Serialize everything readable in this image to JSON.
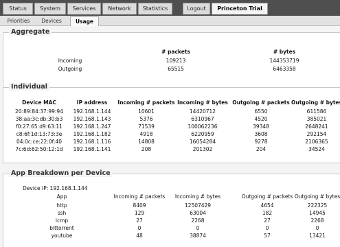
{
  "nav": {
    "tabs": [
      "Status",
      "System",
      "Services",
      "Network",
      "Statistics",
      "Logout",
      "Princeton Trial"
    ]
  },
  "subnav": {
    "tabs": [
      "Priorities",
      "Devices",
      "Usage"
    ]
  },
  "aggregate": {
    "title": "Aggregate",
    "headers": [
      "# packets",
      "# bytes"
    ],
    "rows": [
      {
        "label": "Incoming",
        "packets": "109213",
        "bytes": "144353719"
      },
      {
        "label": "Outgoing",
        "packets": "65515",
        "bytes": "6463358"
      }
    ]
  },
  "individual": {
    "title": "Individual",
    "headers": [
      "Device MAC",
      "IP address",
      "Incoming # packets",
      "Incoming # bytes",
      "Outgoing # packets",
      "Outgoing # bytes"
    ],
    "rows": [
      [
        "20:89:84:37:99:94",
        "192.168.1.144",
        "10601",
        "14420712",
        "6550",
        "611586"
      ],
      [
        "38:aa:3c:db:30:b3",
        "192.168.1.143",
        "5376",
        "6310967",
        "4520",
        "385021"
      ],
      [
        "f0:27:65:d9:63:11",
        "192.168.1.247",
        "71539",
        "100062236",
        "39348",
        "2648241"
      ],
      [
        "c8:6f:1d:13:73:3e",
        "192.168.1.182",
        "4918",
        "6220959",
        "3608",
        "292154"
      ],
      [
        "04:0c:ce:22:0f:40",
        "192.168.1.116",
        "14808",
        "16054284",
        "9278",
        "2106365"
      ],
      [
        "7c:6d:62:50:12:1d",
        "192.168.1.141",
        "208",
        "201302",
        "204",
        "34524"
      ]
    ]
  },
  "breakdown": {
    "title": "App Breakdown per Device",
    "device_label": "Device IP: 192.168.1.144",
    "headers": [
      "App",
      "Incoming # packets",
      "Incoming # bytes",
      "Outgoing # packets",
      "Outgoing # bytes"
    ],
    "rows": [
      [
        "http",
        "8409",
        "12507429",
        "4654",
        "222325"
      ],
      [
        "ssh",
        "129",
        "63004",
        "182",
        "14945"
      ],
      [
        "icmp",
        "27",
        "2268",
        "27",
        "2268"
      ],
      [
        "bittorrent",
        "0",
        "0",
        "0",
        "0"
      ],
      [
        "youtube",
        "48",
        "38874",
        "57",
        "13421"
      ]
    ]
  }
}
